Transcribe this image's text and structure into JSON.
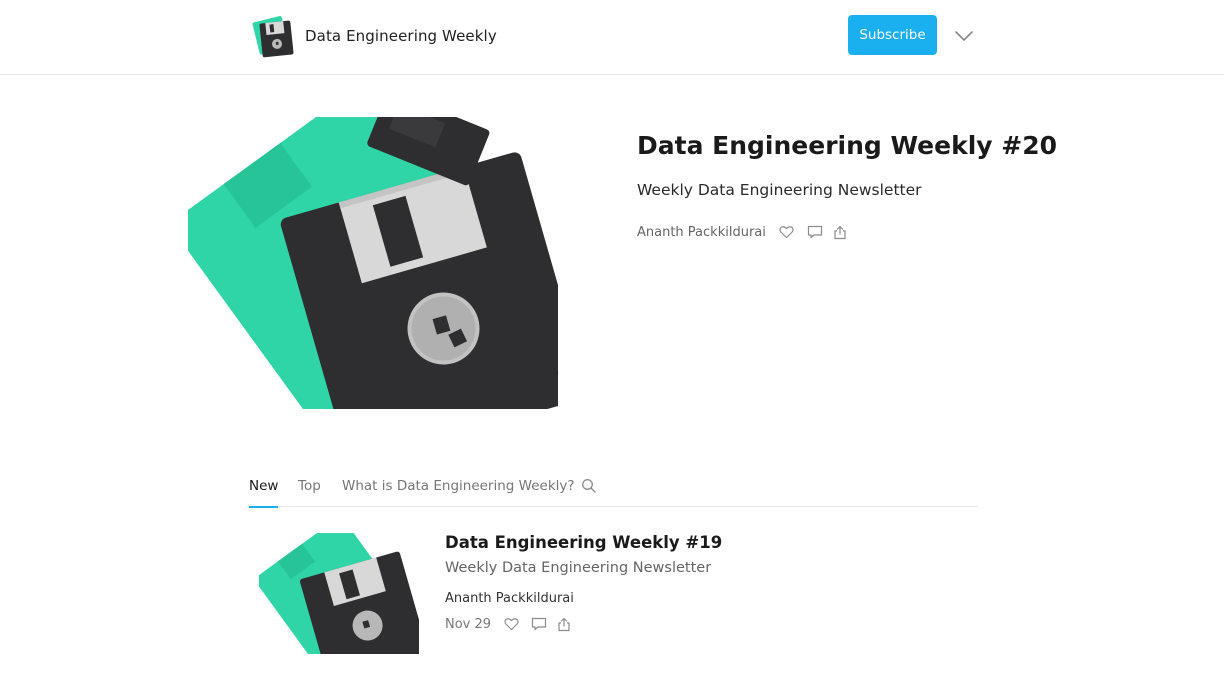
{
  "header": {
    "publication_name": "Data Engineering Weekly",
    "subscribe_label": "Subscribe",
    "logo_icon": "floppy-disk-logo",
    "menu_icon": "chevron-down-icon"
  },
  "hero": {
    "title": "Data Engineering Weekly #20",
    "subtitle": "Weekly Data Engineering Newsletter",
    "author": "Ananth Packkildurai",
    "image_icon": "floppy-disks-image",
    "actions": [
      "heart-icon",
      "comment-icon",
      "share-icon"
    ]
  },
  "tabs": {
    "items": [
      {
        "label": "New",
        "active": true
      },
      {
        "label": "Top",
        "active": false
      },
      {
        "label": "What is Data Engineering Weekly?",
        "active": false
      }
    ],
    "search_icon": "search-icon"
  },
  "posts": [
    {
      "title": "Data Engineering Weekly #19",
      "subtitle": "Weekly Data Engineering Newsletter",
      "author": "Ananth Packkildurai",
      "date": "Nov 29",
      "thumb_icon": "floppy-disks-thumbnail",
      "actions": [
        "heart-icon",
        "comment-icon",
        "share-icon"
      ]
    }
  ],
  "colors": {
    "accent": "#1ab0f0",
    "disk_green": "#2fd5a6",
    "disk_black": "#2e2e30",
    "divider": "#e6e6e6"
  }
}
